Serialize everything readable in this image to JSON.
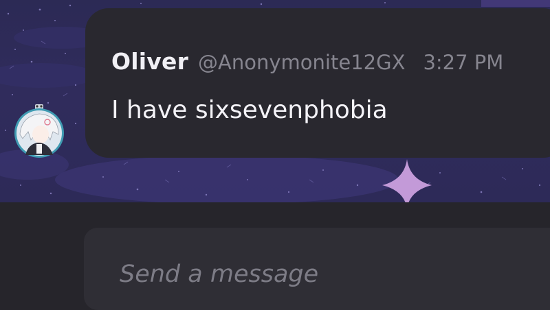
{
  "background": {
    "wallpaper": "purple-starry-night",
    "colors": {
      "sky": "#2d2a58",
      "sparkle": "#c39ad8",
      "cloud": "#3a3470"
    }
  },
  "message": {
    "sender_name": "Oliver",
    "sender_handle": "@Anonymonite12GX",
    "time": "3:27 PM",
    "text": "I have sixsevenphobia",
    "avatar": "anime-character-avatar"
  },
  "composer": {
    "placeholder": "Send a message",
    "value": ""
  },
  "colors": {
    "card": "#29282f",
    "name": "#f1f0f5",
    "meta": "#86858f",
    "composer_bg": "#2f2e35",
    "app_bg": "#26252b"
  }
}
